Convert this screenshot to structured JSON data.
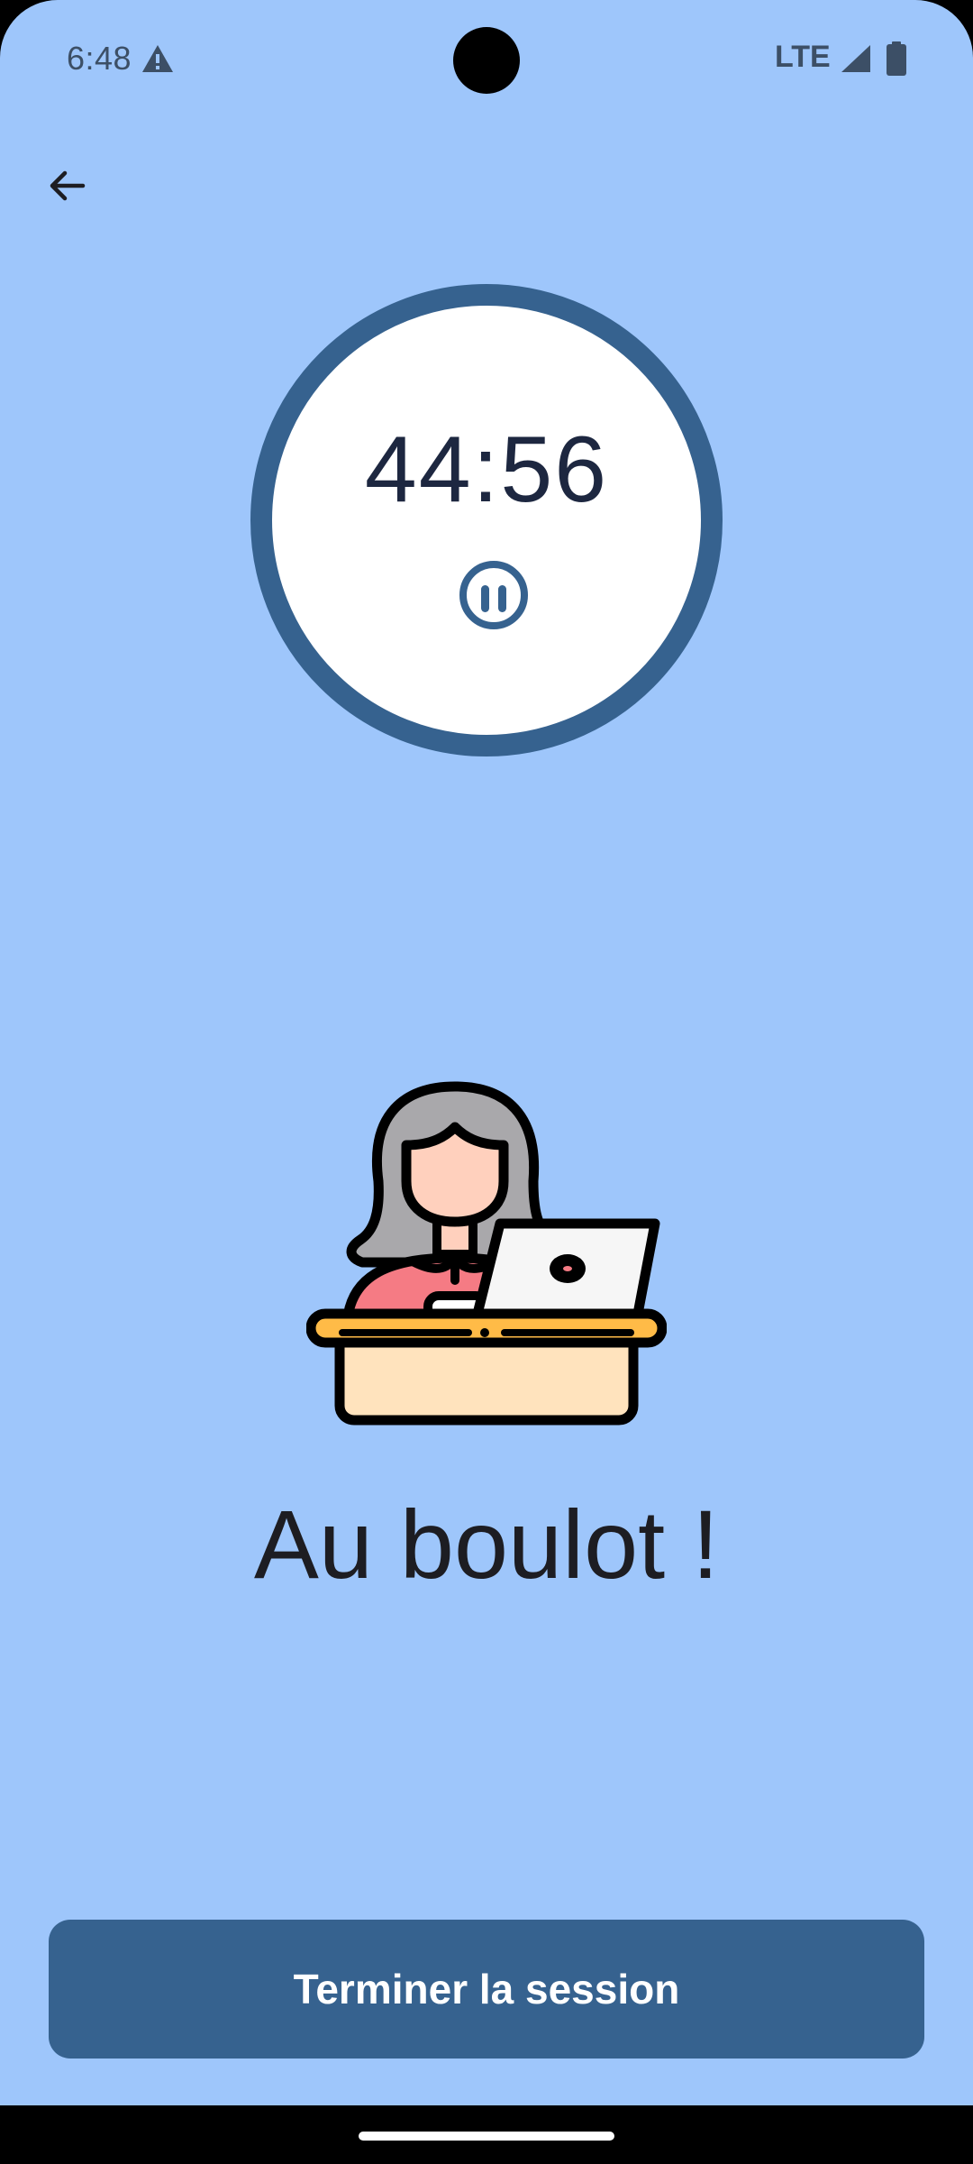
{
  "status_bar": {
    "time": "6:48",
    "network": "LTE",
    "alert_icon": "warning-icon",
    "signal_icon": "signal-icon",
    "battery_icon": "battery-icon"
  },
  "header": {
    "back_icon": "arrow-back-icon"
  },
  "timer": {
    "time_remaining": "44:56",
    "pause_icon": "pause-icon"
  },
  "illustration": {
    "icon": "person-at-laptop-desk-icon"
  },
  "message": {
    "text": "Au boulot !"
  },
  "actions": {
    "end_session_label": "Terminer la session"
  },
  "colors": {
    "background": "#9ec6fb",
    "accent": "#36628f",
    "timer_text": "#1d2740"
  }
}
